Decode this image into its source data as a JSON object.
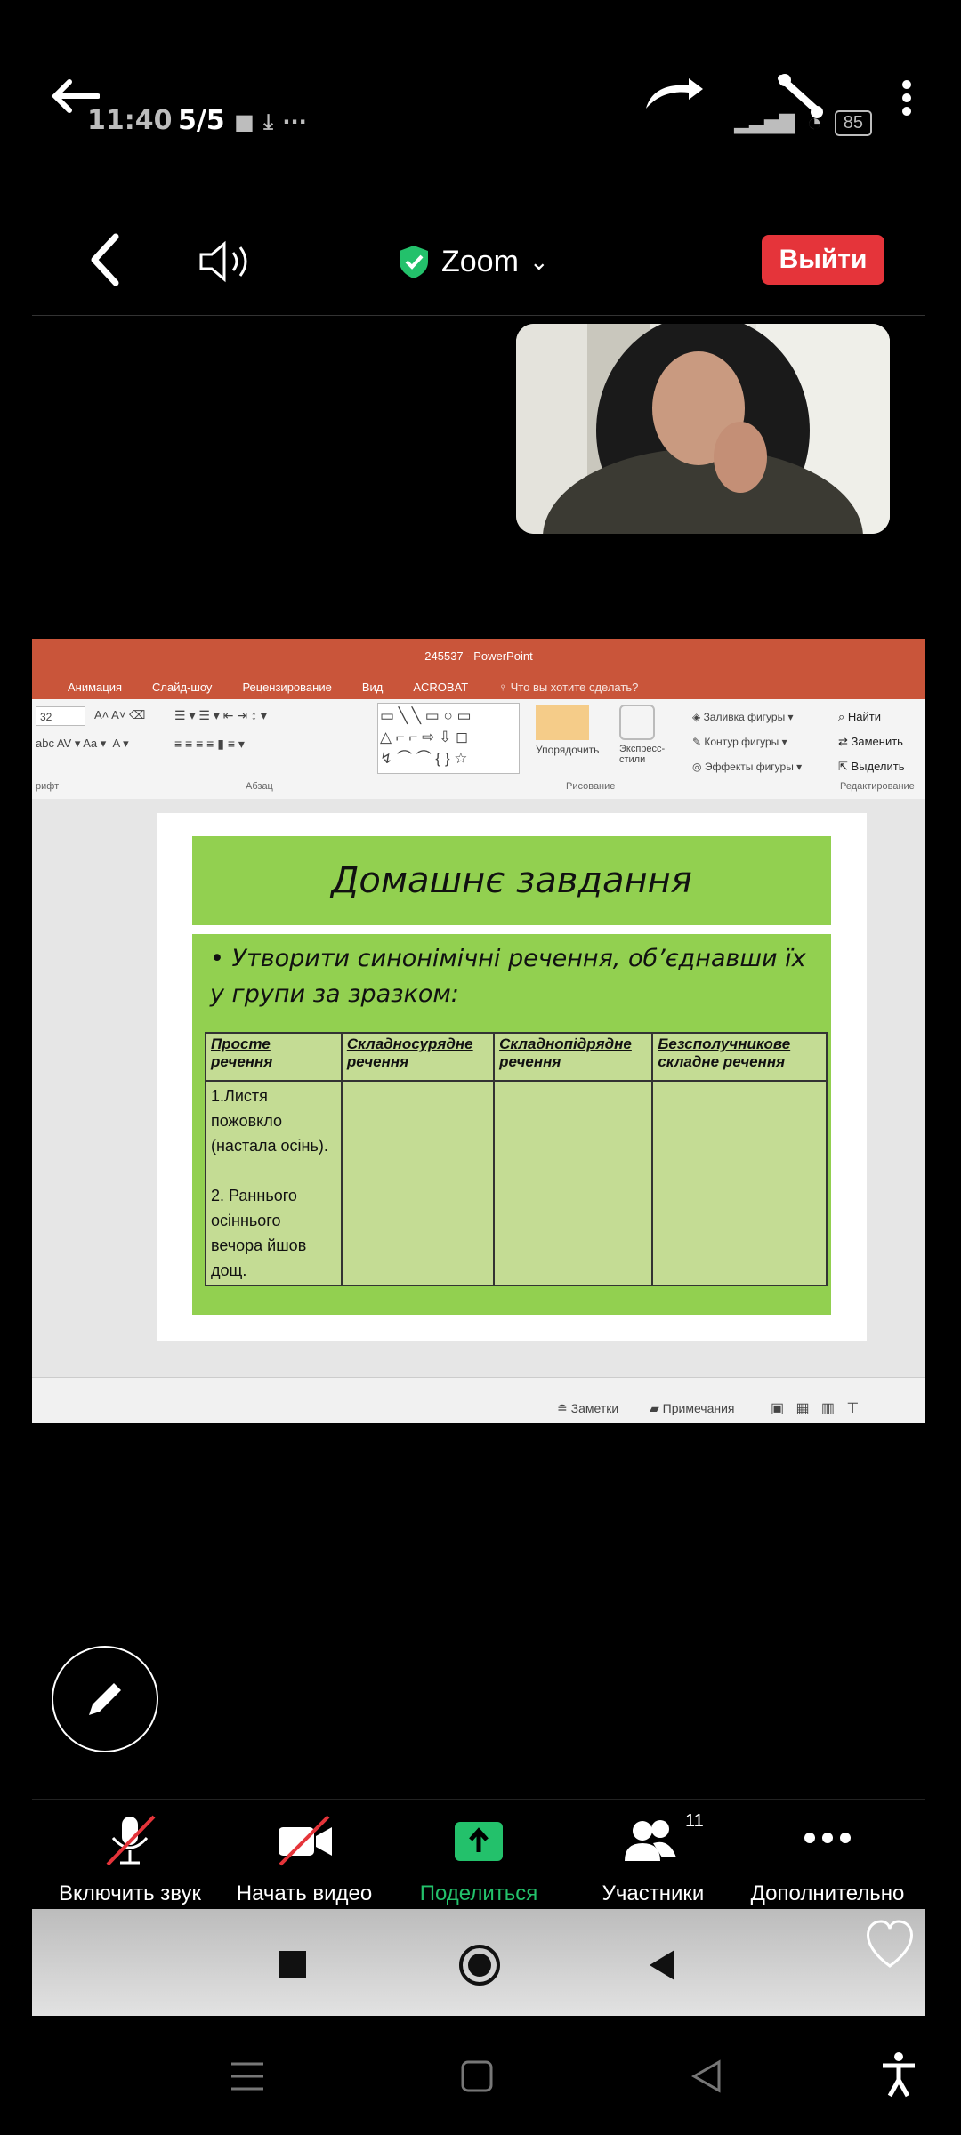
{
  "status_bar": {
    "time": "11:40",
    "page_counter": "5/5",
    "battery": "85"
  },
  "zoom_header": {
    "title": "Zoom",
    "exit_label": "Выйти"
  },
  "powerpoint": {
    "window_title": "245537 - PowerPoint",
    "tabs": [
      "Анимация",
      "Слайд-шоу",
      "Рецензирование",
      "Вид",
      "ACROBAT",
      "Что вы хотите сделать?"
    ],
    "ribbon": {
      "font_size": "32",
      "shape_fill": "Заливка фигуры",
      "shape_outline": "Контур фигуры",
      "shape_effects": "Эффекты фигуры",
      "arrange": "Упорядочить",
      "quick_styles": "Экспресс-стили",
      "find": "Найти",
      "replace": "Заменить",
      "select": "Выделить",
      "group_font": "рифт",
      "group_paragraph": "Абзац",
      "group_drawing": "Рисование",
      "group_editing": "Редактирование"
    },
    "slide": {
      "title": "Домашнє завдання",
      "bullet": "Утворити синонімічні речення, об’єднавши їх у групи за зразком:",
      "table_headers": [
        "Просте речення",
        "Складносурядне речення",
        "Складнопідрядне речення",
        "Безсполучникове складне речення"
      ],
      "table_cells": [
        "1.Листя пожовкло (настала осінь).",
        "2. Раннього осіннього вечора йшов дощ."
      ]
    },
    "statusbar": {
      "notes": "Заметки",
      "comments": "Примечания"
    }
  },
  "toolbar": {
    "unmute": "Включить звук",
    "start_video": "Начать видео",
    "share": "Поделиться",
    "participants": "Участники",
    "participants_count": "11",
    "more": "Дополнительно"
  },
  "colors": {
    "exit_red": "#e5343a",
    "share_green": "#23c16b",
    "slide_green": "#92d050",
    "ppt_orange": "#c9553a"
  }
}
